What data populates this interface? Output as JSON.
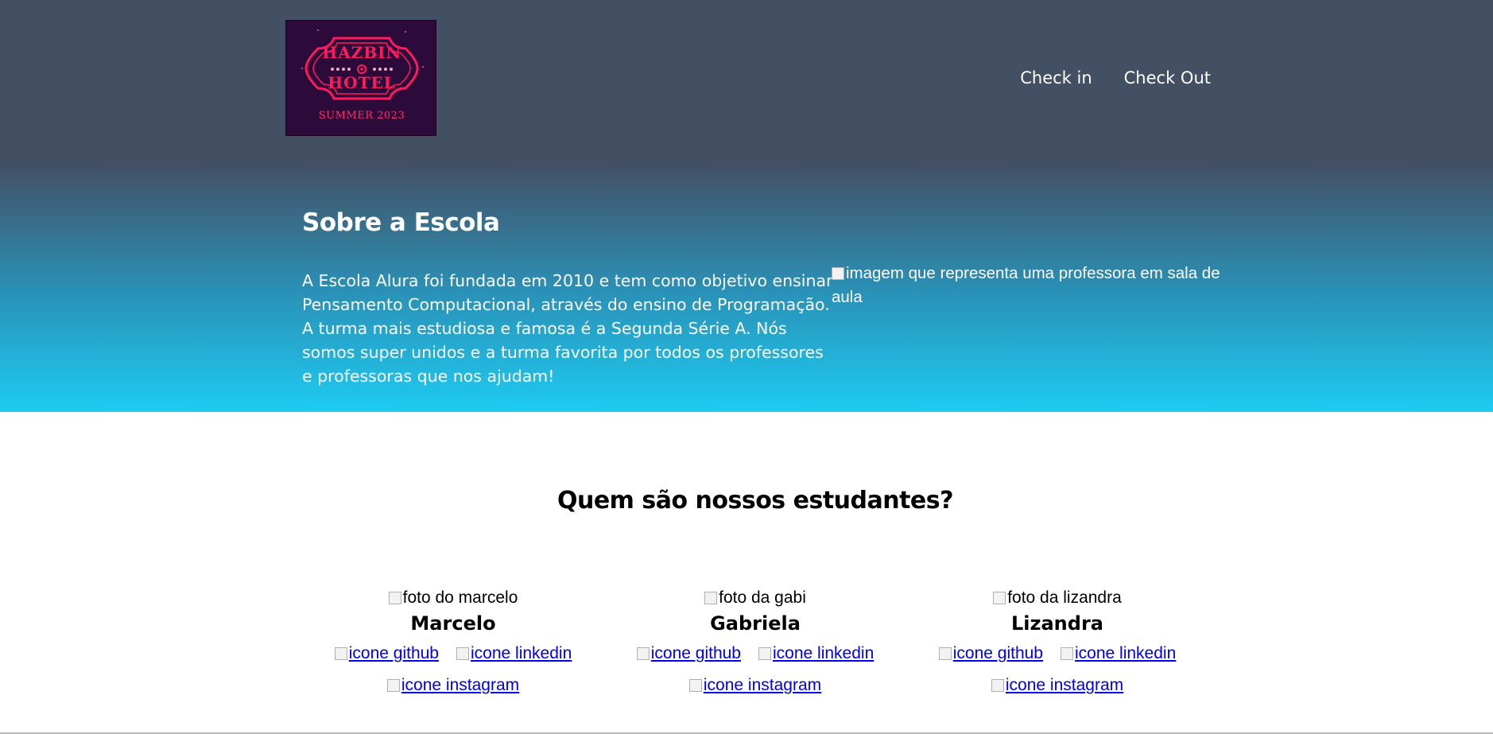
{
  "header": {
    "logo": {
      "word_top": "HAZBIN",
      "word_bottom": "HOTEL",
      "subtitle": "SUMMER 2023"
    },
    "nav": [
      {
        "label": "Check in"
      },
      {
        "label": "Check Out"
      }
    ]
  },
  "about": {
    "title": "Sobre a Escola",
    "text": "A Escola Alura foi fundada em 2010 e tem como objetivo ensinar Pensamento Computacional, através do ensino de Programação. A turma mais estudiosa e famosa é a Segunda Série A. Nós somos super unidos e a turma favorita por todos os professores e professoras que nos ajudam!",
    "image_alt": "imagem que representa uma professora em sala de aula"
  },
  "students": {
    "title": "Quem são nossos estudantes?",
    "items": [
      {
        "photo_alt": "foto do marcelo",
        "name": "Marcelo",
        "github": "icone github",
        "linkedin": "icone linkedin",
        "instagram": "icone instagram"
      },
      {
        "photo_alt": "foto da gabi",
        "name": "Gabriela",
        "github": "icone github",
        "linkedin": "icone linkedin",
        "instagram": "icone instagram"
      },
      {
        "photo_alt": "foto da lizandra",
        "name": "Lizandra",
        "github": "icone github",
        "linkedin": "icone linkedin",
        "instagram": "icone instagram"
      }
    ]
  },
  "colors": {
    "header_bg": "#434f63",
    "hero_bottom": "#1ecbf2",
    "logo_bg": "#2c0a3a",
    "logo_pink": "#ff1a5c",
    "link": "#0000ee"
  }
}
